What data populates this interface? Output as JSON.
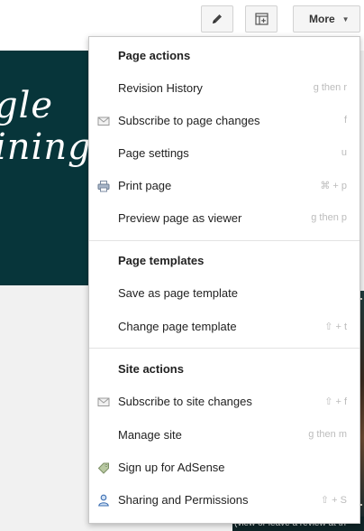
{
  "toolbar": {
    "more_label": "More",
    "edit_icon": "pencil-icon",
    "layout_icon": "page-layout-icon"
  },
  "background": {
    "banner_text": "gle\nining",
    "footer_text": "(view or leave a review at th"
  },
  "menu": {
    "page_actions": {
      "title": "Page actions",
      "items": [
        {
          "label": "Revision History",
          "shortcut": "g then r",
          "icon": ""
        },
        {
          "label": "Subscribe to page changes",
          "shortcut": "f",
          "icon": "envelope-icon"
        },
        {
          "label": "Page settings",
          "shortcut": "u",
          "icon": ""
        },
        {
          "label": "Print page",
          "shortcut": "⌘ + p",
          "icon": "printer-icon"
        },
        {
          "label": "Preview page as viewer",
          "shortcut": "g then p",
          "icon": ""
        }
      ]
    },
    "page_templates": {
      "title": "Page templates",
      "items": [
        {
          "label": "Save as page template",
          "shortcut": ""
        },
        {
          "label": "Change page template",
          "shortcut": "⇧ + t"
        }
      ]
    },
    "site_actions": {
      "title": "Site actions",
      "items": [
        {
          "label": "Subscribe to site changes",
          "shortcut": "⇧ + f",
          "icon": "envelope-icon"
        },
        {
          "label": "Manage site",
          "shortcut": "g then m",
          "icon": ""
        },
        {
          "label": "Sign up for AdSense",
          "shortcut": "",
          "icon": "tag-icon"
        },
        {
          "label": "Sharing and Permissions",
          "shortcut": "⇧ + S",
          "icon": "person-icon"
        }
      ]
    }
  },
  "colors": {
    "banner": "#07353a",
    "menu_bg": "#ffffff",
    "shortcut_text": "#bcbcbc"
  }
}
